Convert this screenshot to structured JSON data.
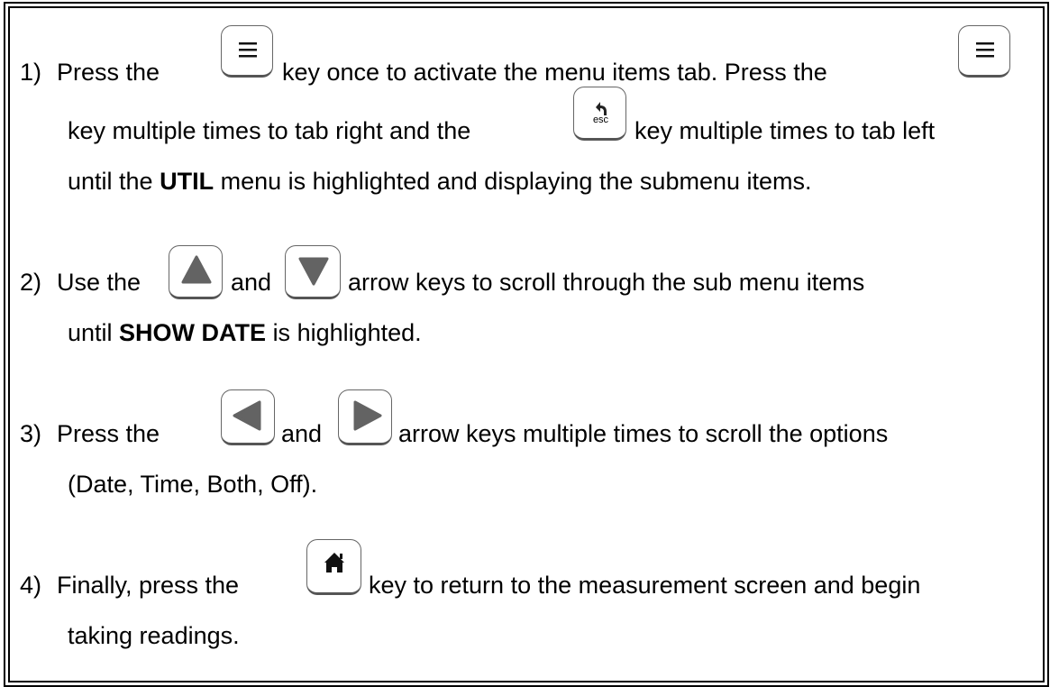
{
  "steps": [
    {
      "num": "1)",
      "l1a": "Press the",
      "l1b": "key once to activate the menu items tab.  Press the",
      "l2a": "key multiple times to tab right and the",
      "l2b": "key multiple times to tab left",
      "l3a": "until the",
      "l3b": "UTIL",
      "l3c": "menu is highlighted and displaying the submenu items."
    },
    {
      "num": "2)",
      "l1a": "Use the",
      "l1b": "and",
      "l1c": "arrow keys to scroll through the sub menu items",
      "l2a": "until",
      "l2b": "SHOW DATE",
      "l2c": "is highlighted."
    },
    {
      "num": "3)",
      "l1a": "Press the",
      "l1b": "and",
      "l1c": "arrow keys multiple times to scroll the options",
      "l2": "(Date, Time, Both, Off)."
    },
    {
      "num": "4)",
      "l1a": "Finally, press the",
      "l1b": "key to return to the measurement screen and begin",
      "l2": "taking readings."
    }
  ],
  "keys": {
    "esc_label": "esc"
  },
  "icons": [
    "menu-icon",
    "esc-icon",
    "up-arrow-icon",
    "down-arrow-icon",
    "left-arrow-icon",
    "right-arrow-icon",
    "home-icon"
  ]
}
